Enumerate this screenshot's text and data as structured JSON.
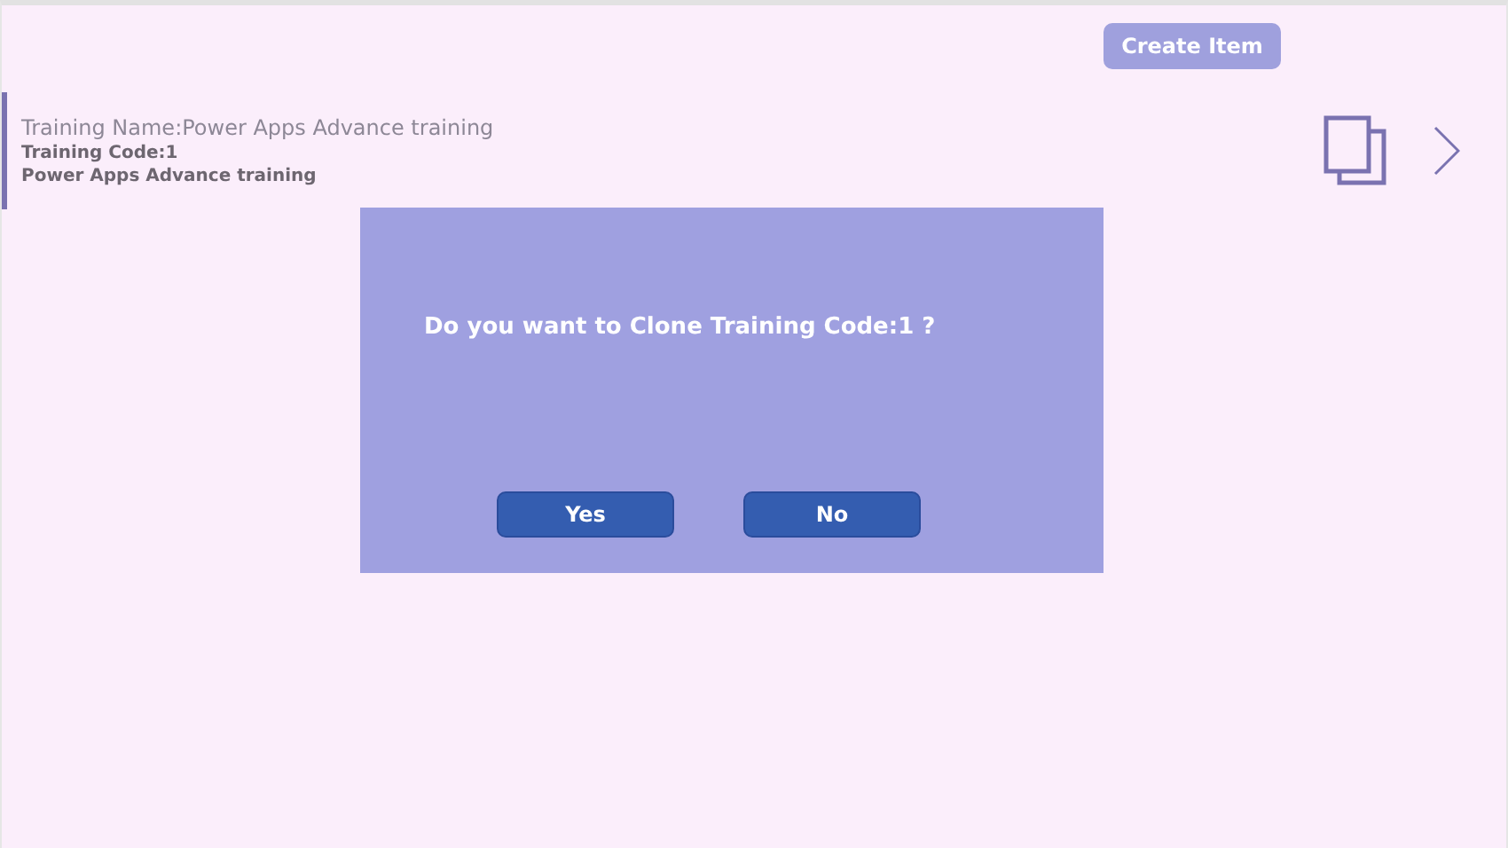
{
  "header": {
    "create_button": "Create Item"
  },
  "list_item": {
    "title": "Training Name:Power Apps Advance training",
    "code": "Training Code:1",
    "subtitle": "Power Apps Advance training"
  },
  "dialog": {
    "message": "Do you want to Clone Training Code:1 ?",
    "buttons": [
      "Yes",
      "No"
    ]
  }
}
